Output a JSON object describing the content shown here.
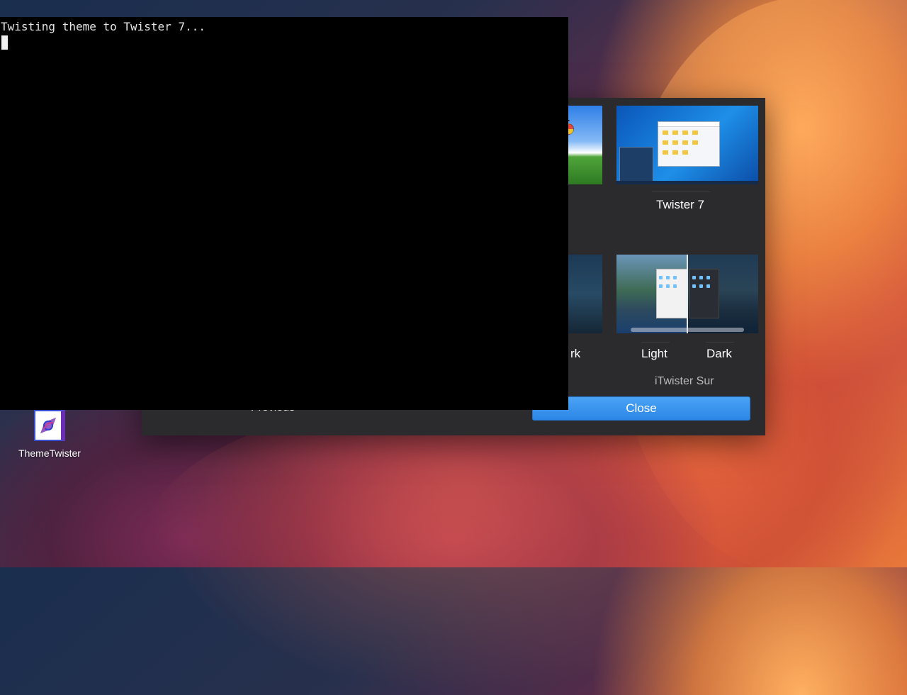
{
  "desktop": {
    "icons": [
      {
        "label": "ThemeTwister",
        "icon": "themetwister-app-icon"
      }
    ]
  },
  "theme_dialog": {
    "themes": [
      {
        "name": "Twister 7",
        "thumbnail": "windows-7-preview"
      },
      {
        "variant_partial": "rk",
        "thumbnail": "macos-dark-preview-partial"
      }
    ],
    "sur_theme": {
      "name": "iTwister Sur",
      "variants": [
        "Light",
        "Dark"
      ]
    },
    "buttons": {
      "previous": "Previous",
      "close": "Close"
    }
  },
  "console": {
    "output": "Twisting theme to Twister 7..."
  },
  "colors": {
    "close_button": "#2c86e6",
    "dialog_bg": "#2b2b2d",
    "console_bg": "#000000"
  }
}
